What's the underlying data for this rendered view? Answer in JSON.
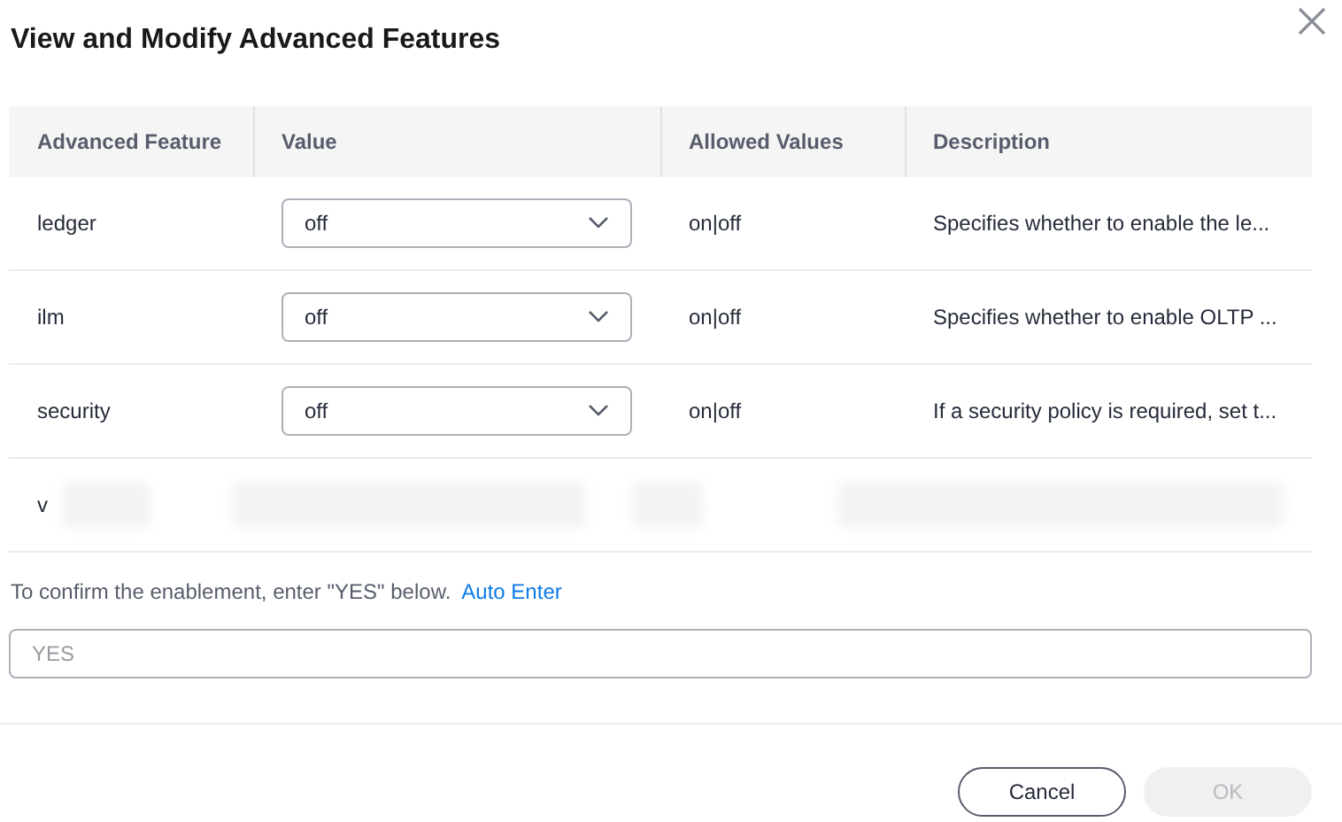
{
  "dialog": {
    "title": "View and Modify Advanced Features"
  },
  "table": {
    "columns": [
      "Advanced Feature",
      "Value",
      "Allowed Values",
      "Description"
    ],
    "rows": [
      {
        "feature": "ledger",
        "value": "off",
        "allowed": "on|off",
        "description": "Specifies whether to enable the le...",
        "blurred": false
      },
      {
        "feature": "ilm",
        "value": "off",
        "allowed": "on|off",
        "description": "Specifies whether to enable OLTP ...",
        "blurred": false
      },
      {
        "feature": "security",
        "value": "off",
        "allowed": "on|off",
        "description": "If a security policy is required, set t...",
        "blurred": false
      },
      {
        "feature": "v",
        "blurred": true
      }
    ]
  },
  "confirm": {
    "text": "To confirm the enablement, enter \"YES\" below.",
    "link": "Auto Enter",
    "placeholder": "YES"
  },
  "buttons": [
    {
      "label": "Cancel",
      "disabled": false
    },
    {
      "label": "OK",
      "disabled": true
    }
  ]
}
